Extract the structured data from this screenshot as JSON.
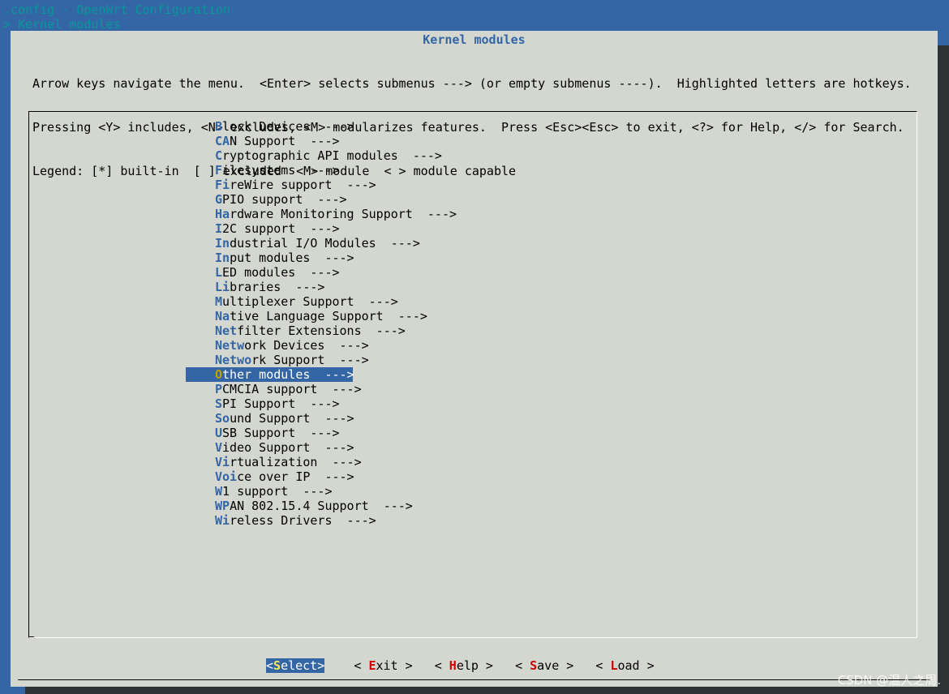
{
  "window": {
    "title": ".config - OpenWrt Configuration",
    "breadcrumb": "> Kernel modules"
  },
  "dialog": {
    "title": "Kernel modules",
    "help_lines": [
      "Arrow keys navigate the menu.  <Enter> selects submenus ---> (or empty submenus ----).  Highlighted letters are hotkeys.",
      "Pressing <Y> includes, <N> excludes, <M> modularizes features.  Press <Esc><Esc> to exit, <?> for Help, </> for Search.",
      "Legend: [*] built-in  [ ] excluded  <M> module  < > module capable"
    ]
  },
  "menu": {
    "selected_index": 17,
    "items": [
      {
        "label": "Block Devices  --->",
        "hotkey_len": 1
      },
      {
        "label": "CAN Support  --->",
        "hotkey_len": 2
      },
      {
        "label": "Cryptographic API modules  --->",
        "hotkey_len": 1
      },
      {
        "label": "Filesystems  --->",
        "hotkey_len": 1
      },
      {
        "label": "FireWire support  --->",
        "hotkey_len": 2
      },
      {
        "label": "GPIO support  --->",
        "hotkey_len": 1
      },
      {
        "label": "Hardware Monitoring Support  --->",
        "hotkey_len": 2
      },
      {
        "label": "I2C support  --->",
        "hotkey_len": 1
      },
      {
        "label": "Industrial I/O Modules  --->",
        "hotkey_len": 2
      },
      {
        "label": "Input modules  --->",
        "hotkey_len": 2
      },
      {
        "label": "LED modules  --->",
        "hotkey_len": 1
      },
      {
        "label": "Libraries  --->",
        "hotkey_len": 2
      },
      {
        "label": "Multiplexer Support  --->",
        "hotkey_len": 1
      },
      {
        "label": "Native Language Support  --->",
        "hotkey_len": 2
      },
      {
        "label": "Netfilter Extensions  --->",
        "hotkey_len": 3
      },
      {
        "label": "Network Devices  --->",
        "hotkey_len": 4
      },
      {
        "label": "Network Support  --->",
        "hotkey_len": 5
      },
      {
        "label": "Other modules  --->",
        "hotkey_len": 1
      },
      {
        "label": "PCMCIA support  --->",
        "hotkey_len": 1
      },
      {
        "label": "SPI Support  --->",
        "hotkey_len": 1
      },
      {
        "label": "Sound Support  --->",
        "hotkey_len": 2
      },
      {
        "label": "USB Support  --->",
        "hotkey_len": 1
      },
      {
        "label": "Video Support  --->",
        "hotkey_len": 1
      },
      {
        "label": "Virtualization  --->",
        "hotkey_len": 2
      },
      {
        "label": "Voice over IP  --->",
        "hotkey_len": 3
      },
      {
        "label": "W1 support  --->",
        "hotkey_len": 1
      },
      {
        "label": "WPAN 802.15.4 Support  --->",
        "hotkey_len": 2
      },
      {
        "label": "Wireless Drivers  --->",
        "hotkey_len": 2
      }
    ]
  },
  "buttons": [
    {
      "pre": "<",
      "hot": "S",
      "post": "elect>",
      "selected": true
    },
    {
      "pre": "< ",
      "hot": "E",
      "post": "xit >",
      "selected": false
    },
    {
      "pre": "< ",
      "hot": "H",
      "post": "elp >",
      "selected": false
    },
    {
      "pre": "< ",
      "hot": "S",
      "post": "ave >",
      "selected": false
    },
    {
      "pre": "< ",
      "hot": "L",
      "post": "oad >",
      "selected": false
    }
  ],
  "watermark": "CSDN @温人之周.",
  "colors": {
    "background": "#3465a4",
    "dialog": "#d3d7cf",
    "hotkey": "#3465a4",
    "button_hotkey": "#cc0000",
    "selected_bg": "#3465a4",
    "selected_hotkey": "#c4a000"
  }
}
